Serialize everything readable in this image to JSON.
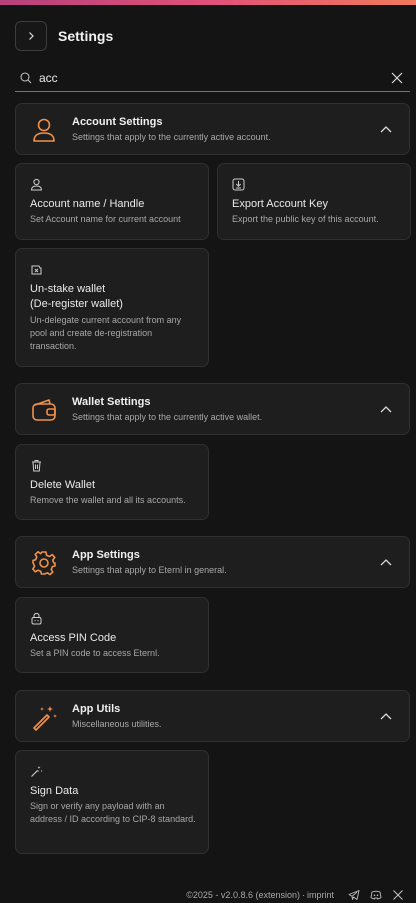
{
  "header": {
    "title": "Settings"
  },
  "search": {
    "value": "acc"
  },
  "sections": [
    {
      "title": "Account Settings",
      "subtitle": "Settings that apply to the currently active account.",
      "icon": "user-icon",
      "items": [
        {
          "title": "Account name / Handle",
          "desc": "Set Account name for current account",
          "icon": "user-icon"
        },
        {
          "title": "Export Account Key",
          "desc": "Export the public key of this account.",
          "icon": "download-icon"
        },
        {
          "title_line1": "Un-stake wallet",
          "title_line2": "(De-register wallet)",
          "desc": "Un-delegate current account from any pool and create de-registration transaction.",
          "icon": "wallet-unstake-icon"
        }
      ]
    },
    {
      "title": "Wallet Settings",
      "subtitle": "Settings that apply to the currently active wallet.",
      "icon": "wallet-icon",
      "items": [
        {
          "title": "Delete Wallet",
          "desc": "Remove the wallet and all its accounts.",
          "icon": "trash-icon"
        }
      ]
    },
    {
      "title": "App Settings",
      "subtitle": "Settings that apply to Eternl in general.",
      "icon": "gear-icon",
      "items": [
        {
          "title": "Access PIN Code",
          "desc": "Set a PIN code to access Eternl.",
          "icon": "lock-icon"
        }
      ]
    },
    {
      "title": "App Utils",
      "subtitle": "Miscellaneous utilities.",
      "icon": "magic-wand-icon",
      "items": [
        {
          "title": "Sign Data",
          "desc": "Sign or verify any payload with an address / ID according to CIP-8 standard.",
          "icon": "magic-wand-icon"
        }
      ]
    }
  ],
  "footer": {
    "copyright": "©2025 - v2.0.8.6 (extension)",
    "separator": "·",
    "imprint": "imprint"
  },
  "colors": {
    "accent": "#f0924a",
    "search_underline": "#d8436a",
    "background": "#141414",
    "card": "#1e1e1e"
  }
}
